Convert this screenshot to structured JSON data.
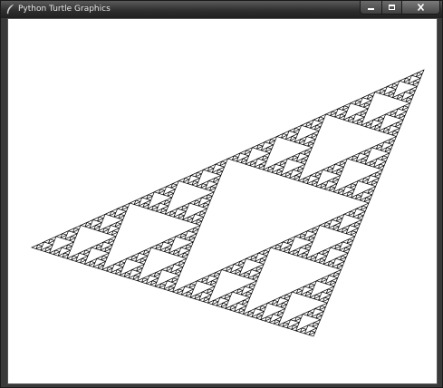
{
  "window": {
    "title": "Python Turtle Graphics",
    "controls": {
      "minimize_icon": "minimize-icon",
      "maximize_icon": "maximize-icon",
      "close_icon": "close-icon"
    },
    "app_icon": "feather-icon"
  },
  "canvas": {
    "background": "#ffffff",
    "drawing": "sierpinski-triangle",
    "stroke_color": "#000000",
    "recursion_depth": 6
  }
}
